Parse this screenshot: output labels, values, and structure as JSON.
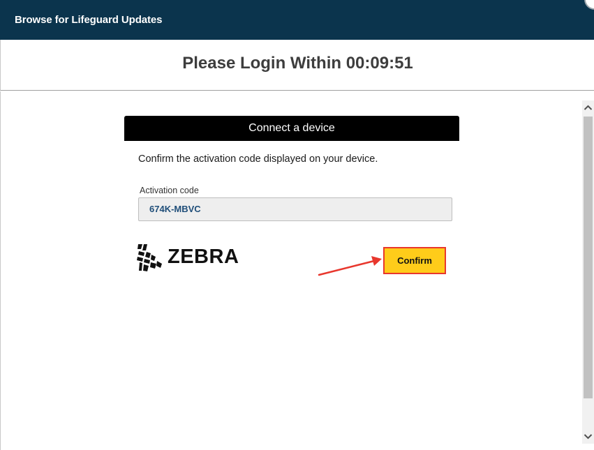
{
  "window": {
    "title": "Browse for Lifeguard Updates",
    "close_icon": "close-icon"
  },
  "header": {
    "heading": "Please Login Within 00:09:51"
  },
  "card": {
    "title": "Connect a device",
    "instruction": "Confirm the activation code displayed on your device.",
    "activation_code_label": "Activation code",
    "activation_code_value": "674K-MBVC",
    "logo_text": "ZEBRA",
    "confirm_label": "Confirm"
  },
  "annotation": {
    "arrow_color": "#e8372d",
    "highlight_color": "#e8372d"
  },
  "colors": {
    "titlebar": "#0b344d",
    "confirm_button": "#ffcc1a"
  }
}
